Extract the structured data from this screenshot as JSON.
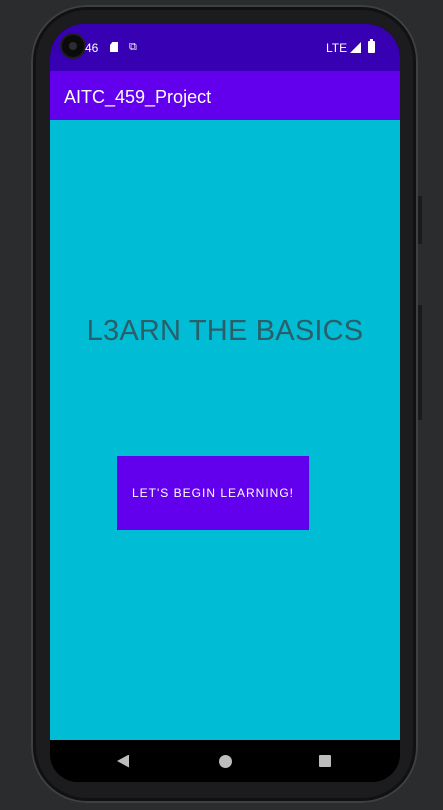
{
  "status_bar": {
    "time": "46",
    "network": "LTE",
    "icons": [
      "camera-cutout",
      "sd-card-icon",
      "sim-icon",
      "signal-icon",
      "battery-icon"
    ]
  },
  "app_bar": {
    "title": "AITC_459_Project"
  },
  "main": {
    "headline": "L3ARN THE BASICS",
    "button_label": "LET'S BEGIN LEARNING!"
  },
  "nav_bar": {
    "buttons": [
      "back-icon",
      "home-icon",
      "recents-icon"
    ]
  },
  "colors": {
    "status_bar": "#3700b3",
    "app_bar": "#6200ee",
    "background": "#00bcd4",
    "headline_text": "#2a5f6a",
    "button": "#6200ee"
  }
}
